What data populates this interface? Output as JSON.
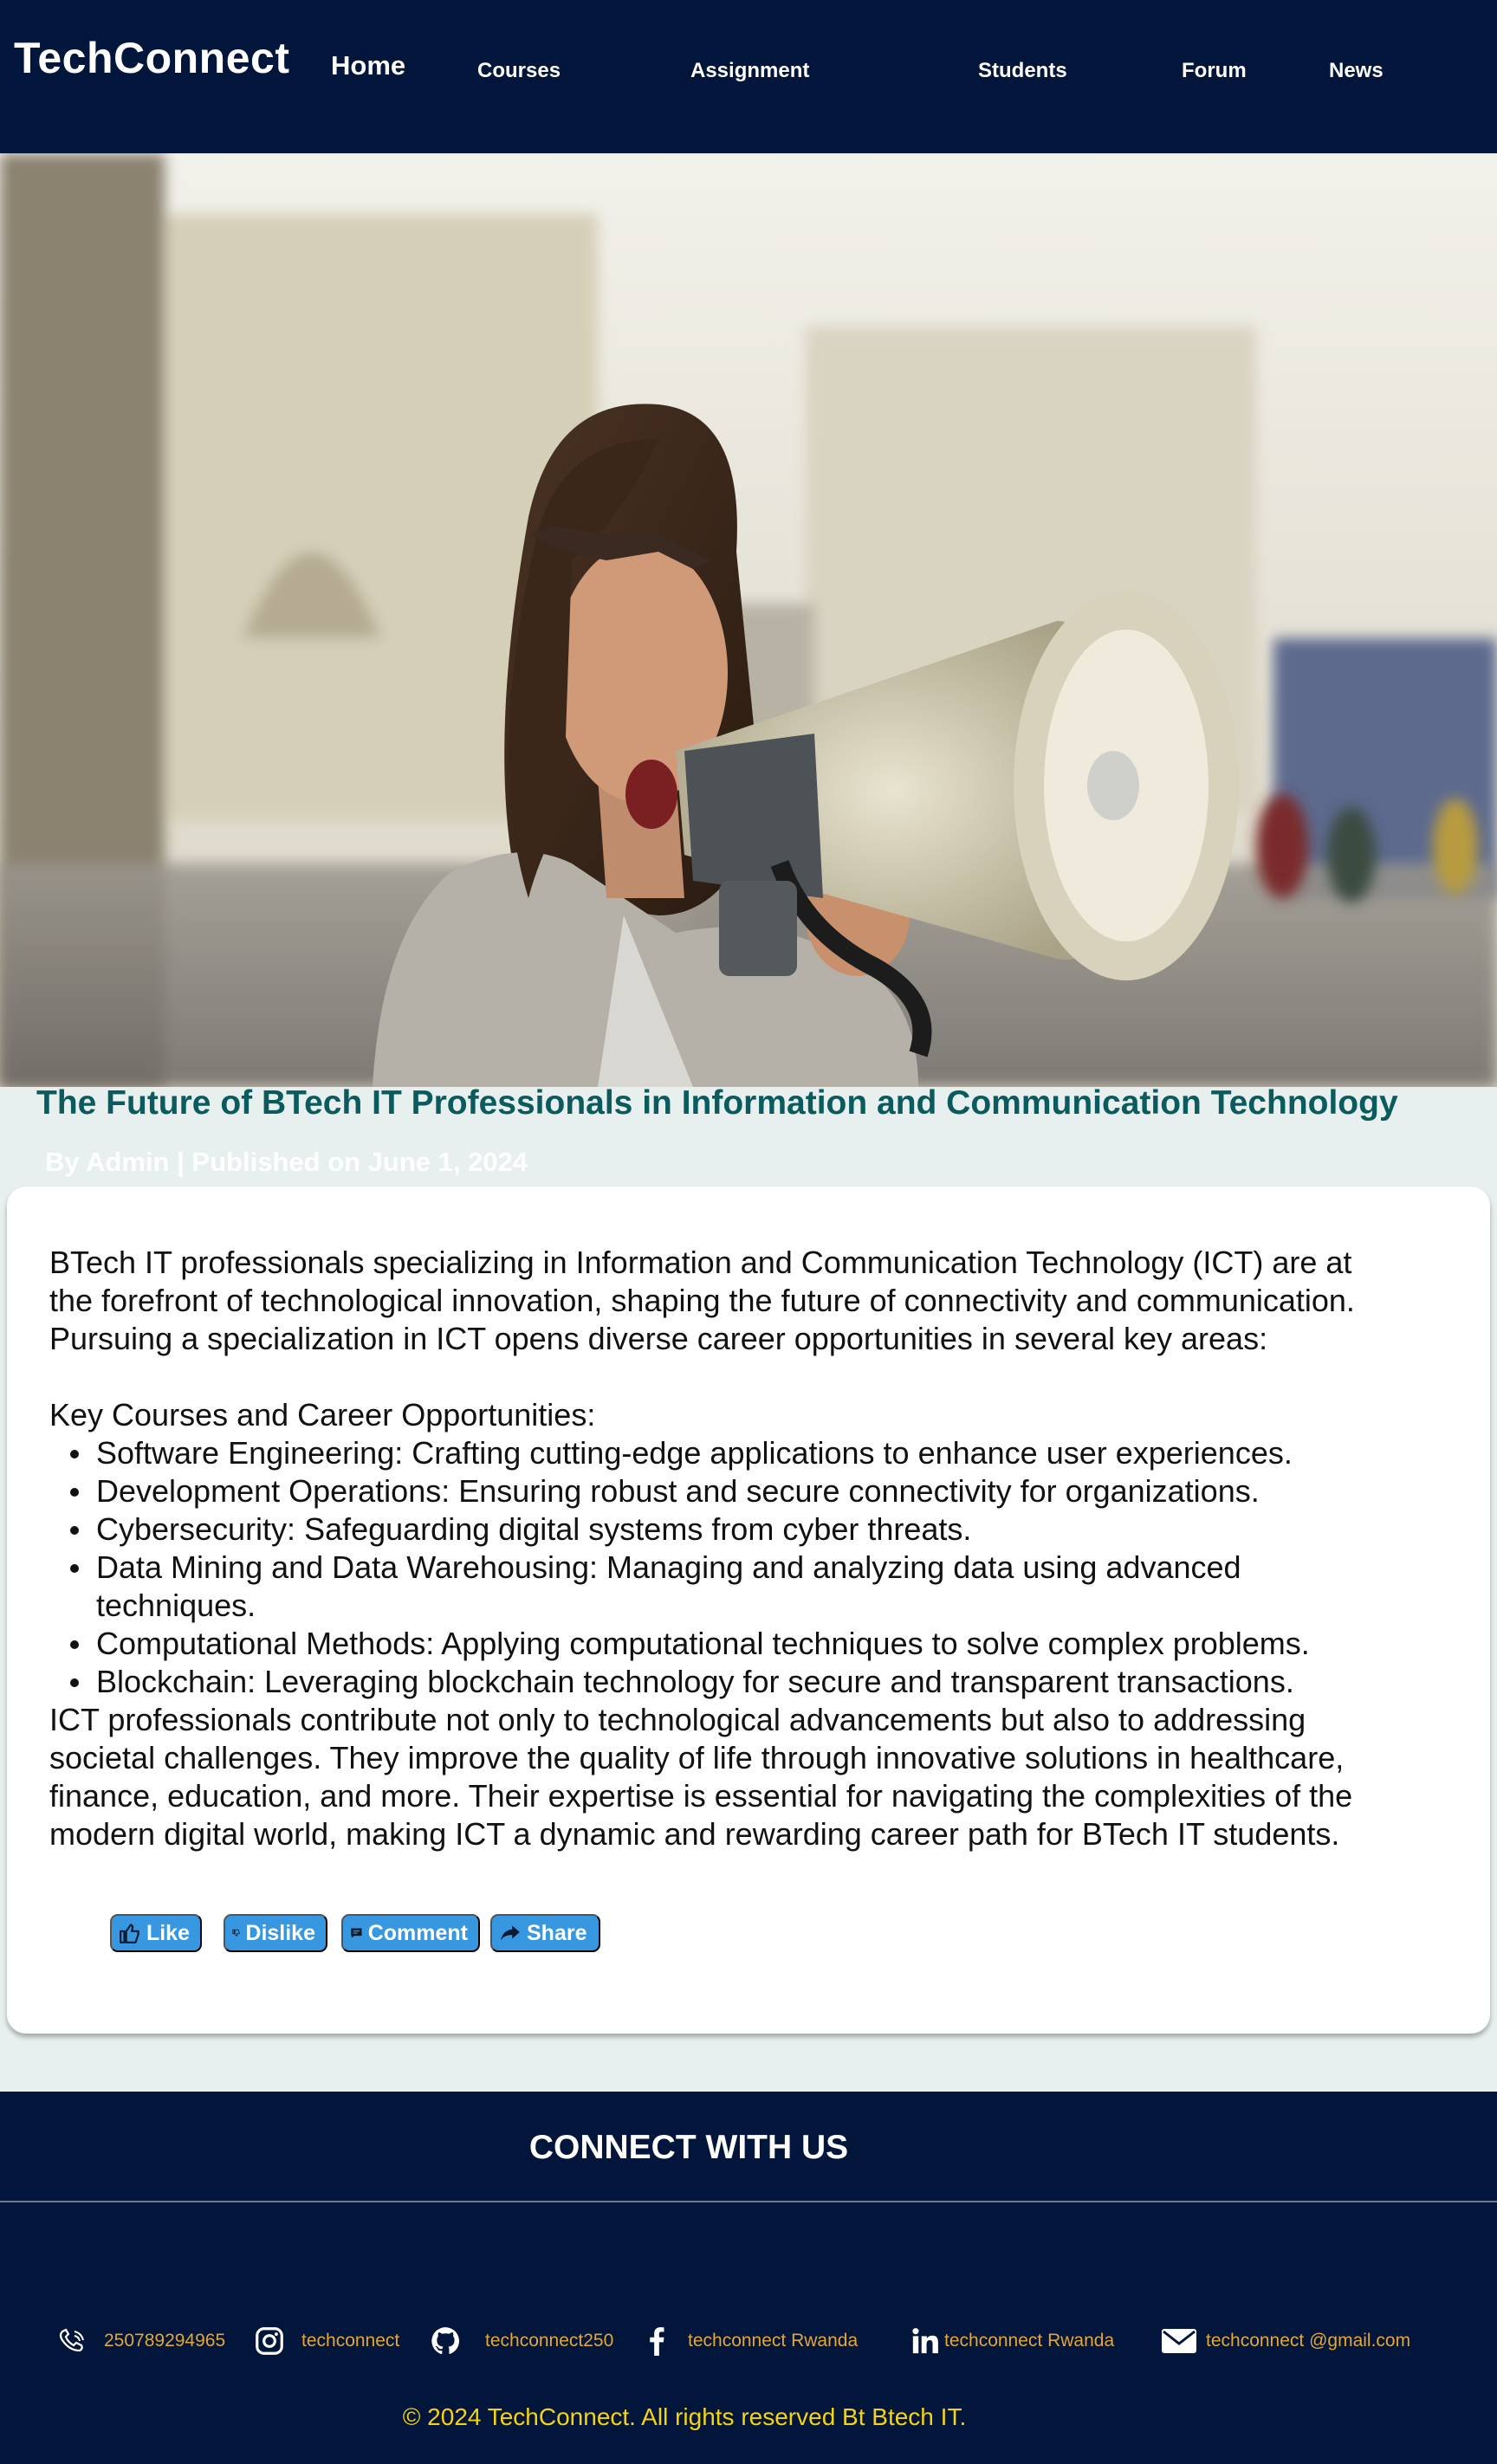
{
  "header": {
    "logo": "TechConnect",
    "nav": {
      "home": "Home",
      "courses": "Courses",
      "assignment": "Assignment",
      "students": "Students",
      "forum": "Forum",
      "news": "News"
    }
  },
  "hero": {
    "image_icon": "photo-woman-with-megaphone"
  },
  "article": {
    "title": "The Future of BTech IT Professionals in Information and Communication Technology",
    "byline": "By Admin | Published on June 1, 2024",
    "intro": [
      "BTech IT professionals specializing in Information and Communication Technology (ICT) are at",
      "the forefront of technological innovation, shaping the future of connectivity and communication.",
      "Pursuing a specialization in ICT opens diverse career opportunities in several key areas:"
    ],
    "list_heading": "Key Courses and Career Opportunities:",
    "items": [
      [
        "Software Engineering: Crafting cutting-edge applications to enhance user experiences."
      ],
      [
        "Development Operations: Ensuring robust and secure connectivity for organizations."
      ],
      [
        "Cybersecurity: Safeguarding digital systems from cyber threats."
      ],
      [
        "Data Mining and Data Warehousing: Managing and analyzing data using advanced",
        "techniques."
      ],
      [
        "Computational Methods: Applying computational techniques to solve complex problems."
      ],
      [
        "Blockchain: Leveraging blockchain technology for secure and transparent transactions."
      ]
    ],
    "conclusion": [
      "ICT professionals contribute not only to technological advancements but also to addressing",
      "societal challenges. They improve the quality of life through innovative solutions in healthcare,",
      "finance, education, and more. Their expertise is essential for navigating the complexities of the",
      "modern digital world, making ICT a dynamic and rewarding career path for BTech IT students."
    ],
    "actions": {
      "like": "Like",
      "dislike": "Dislike",
      "comment": "Comment",
      "share": "Share"
    }
  },
  "footer": {
    "title": "CONNECT WITH US",
    "contacts": {
      "phone": "250789294965",
      "instagram": "techconnect",
      "github": "techconnect250",
      "facebook": "techconnect Rwanda",
      "linkedin": "techconnect Rwanda",
      "email": "techconnect @gmail.com"
    },
    "copyright": "© 2024 TechConnect. All rights reserved Bt Btech IT."
  },
  "colors": {
    "header_bg": "#02153a",
    "title_teal": "#0a5a5e",
    "button_blue": "#3797e0",
    "footer_link": "#e3a637",
    "copyright": "#f5d314",
    "page_bg": "#e8efef"
  }
}
